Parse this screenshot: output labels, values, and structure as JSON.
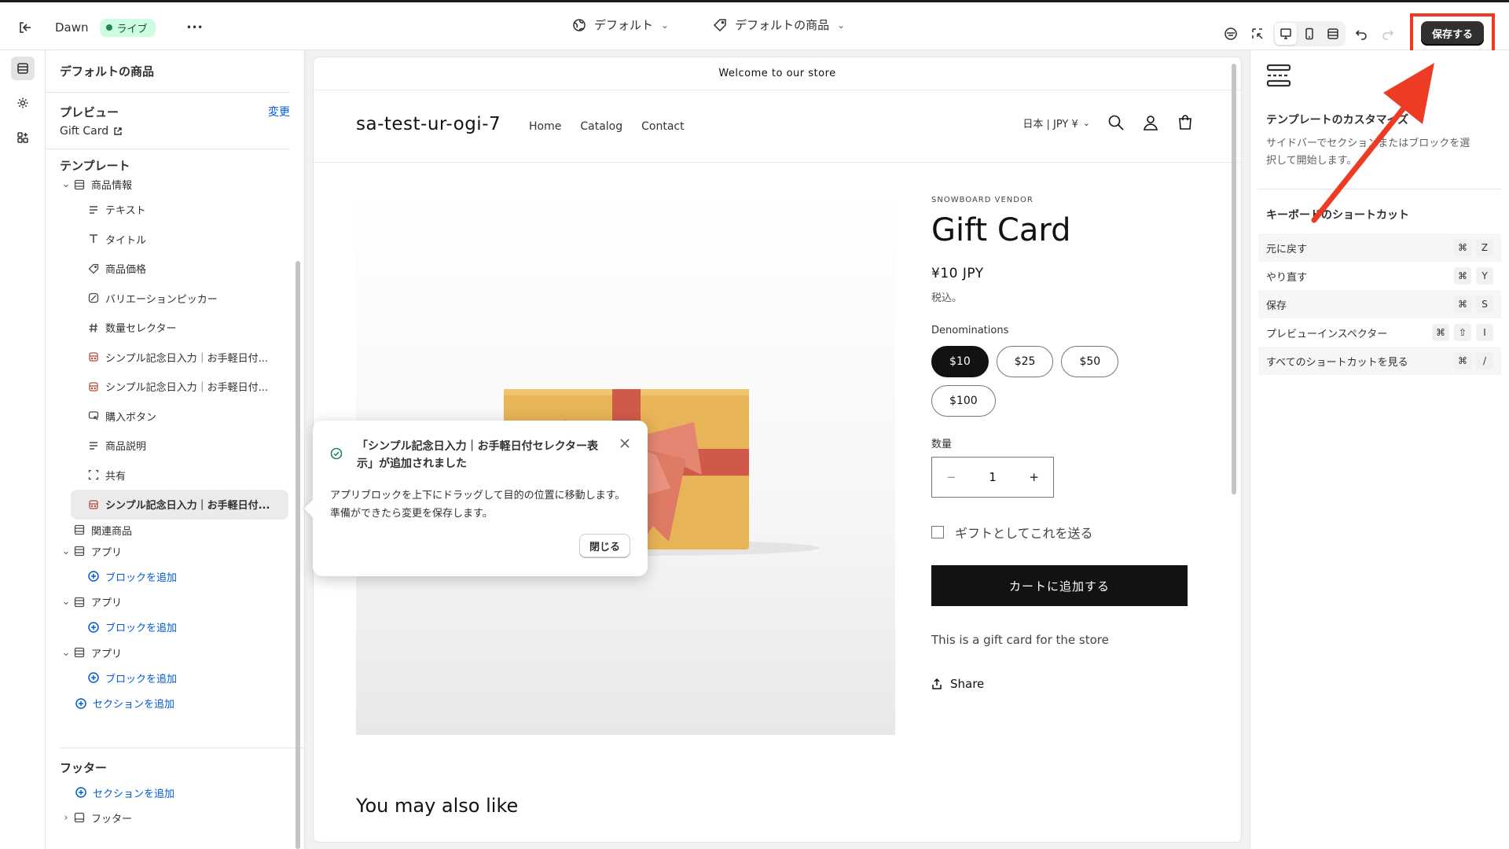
{
  "topbar": {
    "theme_name": "Dawn",
    "live_label": "ライブ",
    "more_label": "•••",
    "theme_select": "デフォルト",
    "template_select": "デフォルトの商品",
    "save_label": "保存する"
  },
  "sidebar": {
    "title": "デフォルトの商品",
    "preview_label": "プレビュー",
    "preview_value": "Gift Card",
    "change_label": "変更",
    "template_heading": "テンプレート",
    "tree": [
      {
        "label": "商品情報",
        "icon": "section-icon",
        "level": 0,
        "chevron": true
      },
      {
        "label": "テキスト",
        "icon": "text-icon",
        "level": 1
      },
      {
        "label": "タイトル",
        "icon": "title-icon",
        "level": 1
      },
      {
        "label": "商品価格",
        "icon": "price-icon",
        "level": 1
      },
      {
        "label": "バリエーションピッカー",
        "icon": "variant-icon",
        "level": 1
      },
      {
        "label": "数量セレクター",
        "icon": "hash-icon",
        "level": 1
      },
      {
        "label": "シンプル記念日入力｜お手軽日付...",
        "icon": "app-block-icon",
        "level": 1
      },
      {
        "label": "シンプル記念日入力｜お手軽日付...",
        "icon": "app-block-icon",
        "level": 1
      },
      {
        "label": "購入ボタン",
        "icon": "buy-button-icon",
        "level": 1
      },
      {
        "label": "商品説明",
        "icon": "text-icon",
        "level": 1
      },
      {
        "label": "共有",
        "icon": "share-frame-icon",
        "level": 1
      },
      {
        "label": "シンプル記念日入力｜お手軽日付...",
        "icon": "app-block-icon",
        "level": 1,
        "selected": true
      },
      {
        "label": "関連商品",
        "icon": "section-icon",
        "level": 0
      },
      {
        "label": "アプリ",
        "icon": "section-icon",
        "level": 0,
        "chevron": true
      },
      {
        "label": "ブロックを追加",
        "icon": "plus-circle-icon",
        "level": 1,
        "link": true
      },
      {
        "label": "アプリ",
        "icon": "section-icon",
        "level": 0,
        "chevron": true
      },
      {
        "label": "ブロックを追加",
        "icon": "plus-circle-icon",
        "level": 1,
        "link": true
      },
      {
        "label": "アプリ",
        "icon": "section-icon",
        "level": 0,
        "chevron": true
      },
      {
        "label": "ブロックを追加",
        "icon": "plus-circle-icon",
        "level": 1,
        "link": true
      },
      {
        "label": "セクションを追加",
        "icon": "plus-circle-icon",
        "level": 0,
        "link": true
      }
    ],
    "footer_heading": "フッター",
    "footer_add": "セクションを追加",
    "footer_item": "フッター"
  },
  "store": {
    "announcement": "Welcome to our store",
    "logo": "sa-test-ur-ogi-7",
    "nav": [
      "Home",
      "Catalog",
      "Contact"
    ],
    "locale": "日本 | JPY ¥",
    "vendor": "SNOWBOARD VENDOR",
    "product_title": "Gift Card",
    "price": "¥10 JPY",
    "tax_note": "税込。",
    "denominations_label": "Denominations",
    "denominations": [
      "$10",
      "$25",
      "$50",
      "$100"
    ],
    "selected_denomination": "$10",
    "quantity_label": "数量",
    "quantity_value": "1",
    "qty_minus": "−",
    "qty_plus": "+",
    "gift_label": "ギフトとしてこれを送る",
    "add_to_cart": "カートに追加する",
    "description": "This is a gift card for the store",
    "share": "Share",
    "also_like": "You may also like"
  },
  "toast": {
    "title": "「シンプル記念日入力｜お手軽日付セレクター表示」が追加されました",
    "body": "アプリブロックを上下にドラッグして目的の位置に移動します。準備ができたら変更を保存します。",
    "close_label": "閉じる"
  },
  "rpanel": {
    "title": "テンプレートのカスタマイズ",
    "desc": "サイドバーでセクションまたはブロックを選択して開始します。",
    "shortcuts_heading": "キーボードのショートカット",
    "shortcuts": [
      {
        "label": "元に戻す",
        "keys": [
          "⌘",
          "Z"
        ]
      },
      {
        "label": "やり直す",
        "keys": [
          "⌘",
          "Y"
        ]
      },
      {
        "label": "保存",
        "keys": [
          "⌘",
          "S"
        ]
      },
      {
        "label": "プレビューインスペクター",
        "keys": [
          "⌘",
          "⇧",
          "I"
        ]
      },
      {
        "label": "すべてのショートカットを見る",
        "keys": [
          "⌘",
          "/"
        ]
      }
    ]
  },
  "colors": {
    "accent_link": "#005bd3",
    "live_bg": "#cdfee1",
    "annotation_red": "#ee3b24",
    "gift_box": "#e7b457",
    "ribbon": "#cf5a4a"
  }
}
